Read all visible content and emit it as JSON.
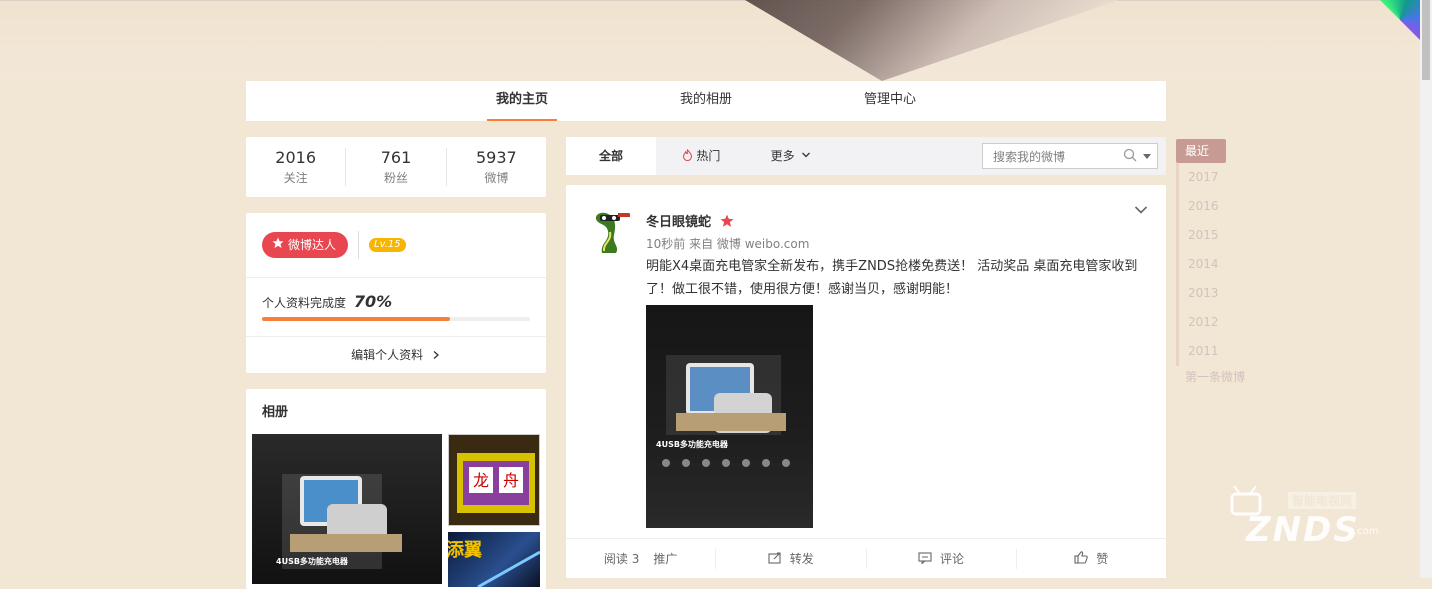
{
  "nav": {
    "tabs": [
      {
        "label": "我的主页",
        "active": true
      },
      {
        "label": "我的相册",
        "active": false
      },
      {
        "label": "管理中心",
        "active": false
      }
    ]
  },
  "stats": [
    {
      "num": "2016",
      "label": "关注"
    },
    {
      "num": "761",
      "label": "粉丝"
    },
    {
      "num": "5937",
      "label": "微博"
    }
  ],
  "profile": {
    "badge": "微博达人",
    "level": "Lv.15",
    "complete_label": "个人资料完成度",
    "complete_pct": "70%",
    "complete_value": 0.7,
    "edit_label": "编辑个人资料"
  },
  "album": {
    "title": "相册"
  },
  "feed": {
    "tabs": [
      "全部",
      "热门",
      "更多"
    ],
    "search_placeholder": "搜索我的微博"
  },
  "post": {
    "author": "冬日眼镜蛇",
    "meta": "10秒前 来自 微博 weibo.com",
    "text": "明能X4桌面充电管家全新发布，携手ZNDS抢楼免费送！ 活动奖品 桌面充电管家收到了！做工很不错，使用很方便！感谢当贝，感谢明能！",
    "image_product_text": "4USB多功能充电器",
    "actions": {
      "read": "阅读 3",
      "promote": "推广",
      "repost": "转发",
      "comment": "评论",
      "like": "赞"
    }
  },
  "timeline": {
    "recent": "最近",
    "years": [
      "2017",
      "2016",
      "2015",
      "2014",
      "2013",
      "2012",
      "2011"
    ],
    "first": "第一条微博"
  },
  "album_images": {
    "small1_chars": [
      "龙",
      "舟"
    ],
    "small2_text": "添翼"
  },
  "watermark": {
    "top": "智能电视网",
    "big": "ZNDS",
    "com": ".com"
  },
  "colors": {
    "accent": "#fa7d3c",
    "vip_red": "#e8474f",
    "level_gold": "#f7b500",
    "page_bg": "#f2e6d4"
  }
}
